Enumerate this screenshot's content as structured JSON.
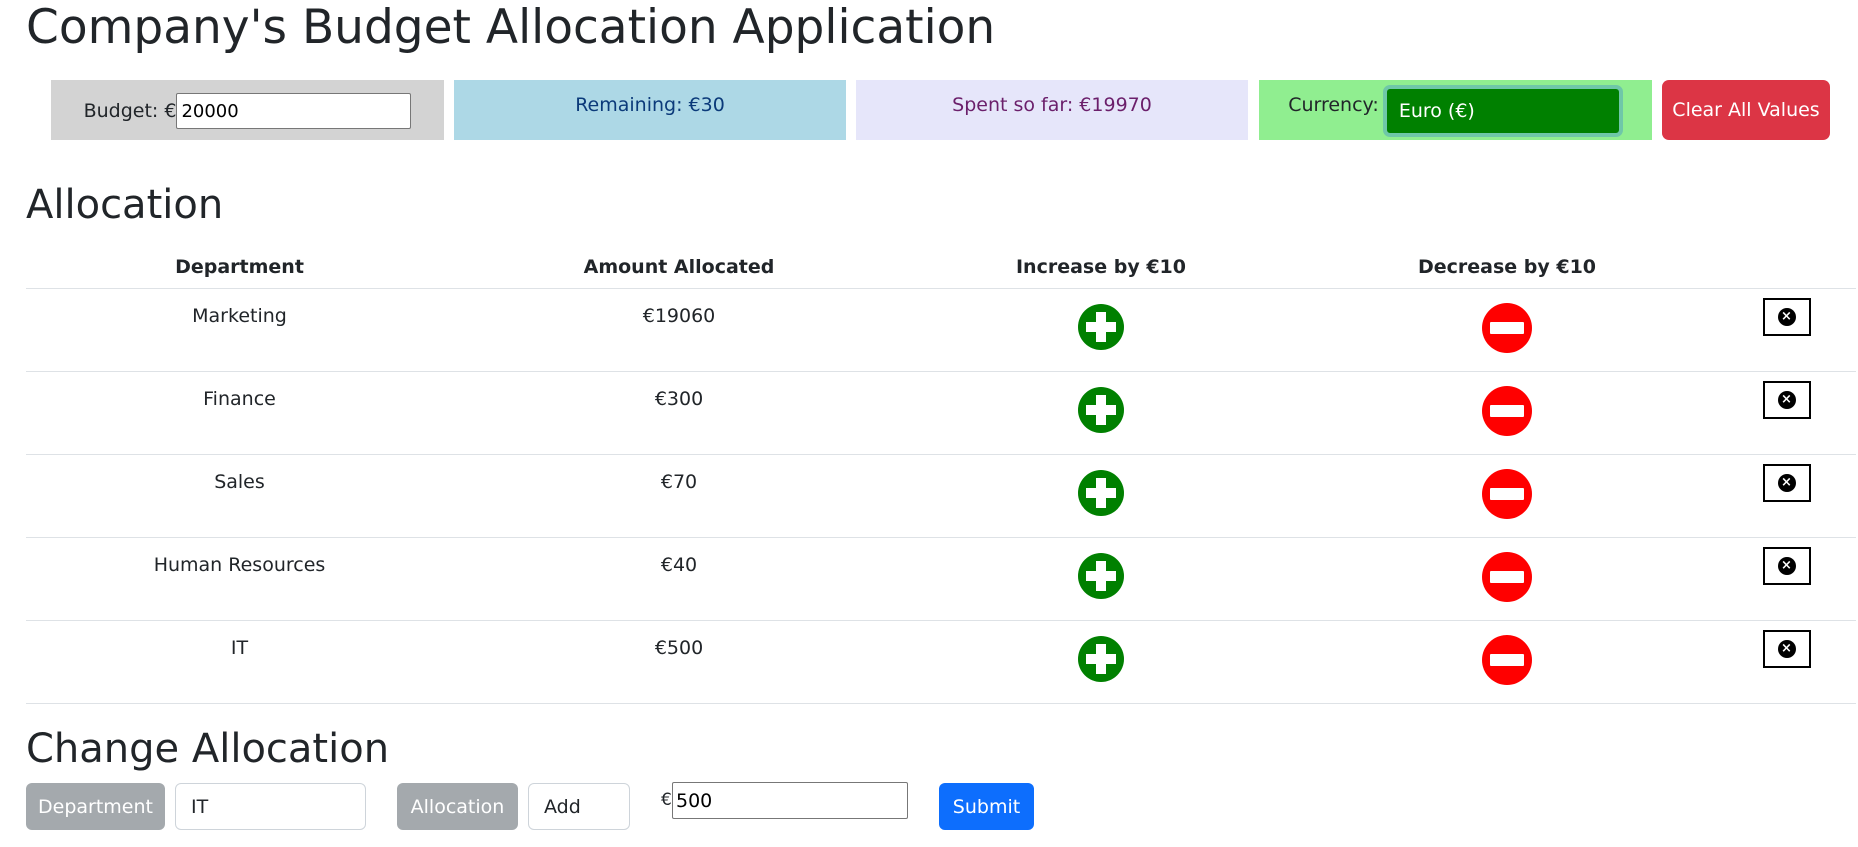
{
  "app": {
    "title": "Company's Budget Allocation Application"
  },
  "summary": {
    "budget_label": "Budget: €",
    "budget_value": "20000",
    "remaining": "Remaining: €30",
    "spent": "Spent so far: €19970",
    "currency_label": "Currency:",
    "currency_selected": "Euro (€)",
    "clear_label": "Clear All Values"
  },
  "allocation": {
    "title": "Allocation",
    "headers": [
      "Department",
      "Amount Allocated",
      "Increase by €10",
      "Decrease by €10",
      ""
    ],
    "rows": [
      {
        "department": "Marketing",
        "amount": "€19060"
      },
      {
        "department": "Finance",
        "amount": "€300"
      },
      {
        "department": "Sales",
        "amount": "€70"
      },
      {
        "department": "Human Resources",
        "amount": "€40"
      },
      {
        "department": "IT",
        "amount": "€500"
      }
    ],
    "icons": {
      "increase": "plus-circle-icon",
      "decrease": "minus-circle-icon",
      "delete": "close-circle-icon"
    },
    "colors": {
      "increase": "#008000",
      "decrease": "#ff0000"
    }
  },
  "change": {
    "title": "Change Allocation",
    "department_label": "Department",
    "department_value": "IT",
    "allocation_label": "Allocation",
    "allocation_value": "Add",
    "currency_symbol": "€",
    "amount_value": "500",
    "submit_label": "Submit"
  }
}
